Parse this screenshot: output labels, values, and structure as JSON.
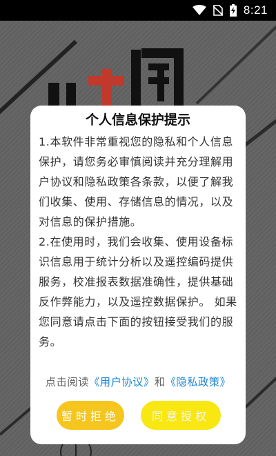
{
  "status_bar": {
    "time": "8:21"
  },
  "dialog": {
    "title": "个人信息保护提示",
    "paragraph1": "1.本软件非常重视您的隐私和个人信息保护，请您务必审慎阅读并充分理解用户协议和隐私政策各条款，以便了解我们收集、使用、存储信息的情况，以及对信息的保护措施。",
    "paragraph2": "2.在使用时，我们会收集、使用设备标识信息用于统计分析以及遥控编码提供服务，校准报表数据准确性，提供基础反作弊能力，以及遥控数据保护。 如果您同意请点击下面的按钮接受我们的服务。",
    "agreement_prefix": "点击阅读",
    "user_agreement_link": "《用户协议》",
    "agreement_and": "和",
    "privacy_policy_link": "《隐私政策》",
    "reject_label": "暂时拒绝",
    "accept_label": "同意授权"
  },
  "colors": {
    "link": "#1e88d6",
    "reject_button": "#f6c51e",
    "accept_button": "#f8e711"
  }
}
